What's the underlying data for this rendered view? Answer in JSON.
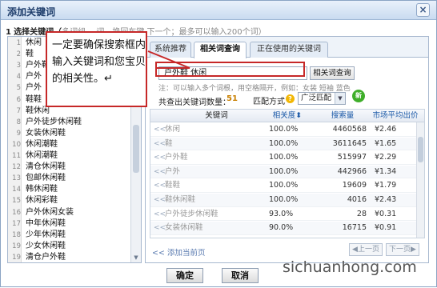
{
  "window": {
    "title": "添加关键词",
    "close_glyph": "×"
  },
  "instruction": {
    "num": "1",
    "text": "选择关键词（",
    "faint": "多词组，   词，换回车键    下一个；最多可以输入200个词）"
  },
  "word_list": {
    "items": [
      {
        "n": "1",
        "t": "休闲"
      },
      {
        "n": "2",
        "t": "鞋"
      },
      {
        "n": "3",
        "t": "户外鞋"
      },
      {
        "n": "4",
        "t": "户外"
      },
      {
        "n": "5",
        "t": "户外"
      },
      {
        "n": "6",
        "t": "鞋鞋"
      },
      {
        "n": "7",
        "t": "鞋休闲"
      },
      {
        "n": "8",
        "t": "户外徒步休闲鞋"
      },
      {
        "n": "9",
        "t": "女装休闲鞋"
      },
      {
        "n": "10",
        "t": "休闲潮鞋"
      },
      {
        "n": "11",
        "t": "休闲潮鞋"
      },
      {
        "n": "12",
        "t": "清仓休闲鞋"
      },
      {
        "n": "13",
        "t": "包邮休闲鞋"
      },
      {
        "n": "14",
        "t": "韩休闲鞋"
      },
      {
        "n": "15",
        "t": "休闲彩鞋"
      },
      {
        "n": "16",
        "t": "户外休闲女装"
      },
      {
        "n": "17",
        "t": "中年休闲鞋"
      },
      {
        "n": "18",
        "t": "少年休闲鞋"
      },
      {
        "n": "19",
        "t": "少女休闲鞋"
      },
      {
        "n": "19",
        "t": "清仓户外鞋"
      }
    ]
  },
  "tabs": [
    {
      "label": "系统推荐"
    },
    {
      "label": "相关词查询"
    },
    {
      "label": "正在使用的关键词"
    }
  ],
  "search": {
    "value": "户外鞋 休闲",
    "button": "相关词查询",
    "hint": "注：可以输入多个词根，用空格隔开，例如：女装  短袖  蓝色"
  },
  "stats": {
    "count_label": "共查出关键词数量：",
    "count_value": "51",
    "match_label": "匹配方式",
    "help_glyph": "?",
    "match_value": "广泛匹配",
    "new_badge": "新"
  },
  "table": {
    "headers": {
      "keyword": "关键词",
      "relevance": "相关度",
      "volume": "搜索量",
      "price": "市场平均出价"
    },
    "sort_glyph": "⬍",
    "rows": [
      {
        "add": "<<",
        "kw": "休闲",
        "rel": "100.0%",
        "vol": "4460568",
        "price": "¥2.46"
      },
      {
        "add": "<<",
        "kw": "鞋",
        "rel": "100.0%",
        "vol": "3611645",
        "price": "¥1.65"
      },
      {
        "add": "<<",
        "kw": "户外鞋",
        "rel": "100.0%",
        "vol": "515997",
        "price": "¥2.29"
      },
      {
        "add": "<<",
        "kw": "户外",
        "rel": "100.0%",
        "vol": "442966",
        "price": "¥1.34"
      },
      {
        "add": "<<",
        "kw": "鞋鞋",
        "rel": "100.0%",
        "vol": "19609",
        "price": "¥1.79"
      },
      {
        "add": "<<",
        "kw": "鞋休闲鞋",
        "rel": "100.0%",
        "vol": "4016",
        "price": "¥2.43"
      },
      {
        "add": "<<",
        "kw": "户外徒步休闲鞋",
        "rel": "93.0%",
        "vol": "28",
        "price": "¥0.31"
      },
      {
        "add": "<<",
        "kw": "女装休闲鞋",
        "rel": "90.0%",
        "vol": "16715",
        "price": "¥0.91"
      }
    ]
  },
  "pager": {
    "add_page": "添加当前页",
    "add_glyph": "<<",
    "prev": "上一页",
    "next": "下一页"
  },
  "footer": {
    "ok": "确定",
    "cancel": "取消"
  },
  "callout": {
    "text": "一定要确保搜索框内输入关键词和您宝贝的相关性。↵"
  },
  "watermark": "sichuanhong.com",
  "colors": {
    "accent_red": "#c62828",
    "link_blue": "#1c5aa8",
    "count_orange": "#c87f00"
  }
}
